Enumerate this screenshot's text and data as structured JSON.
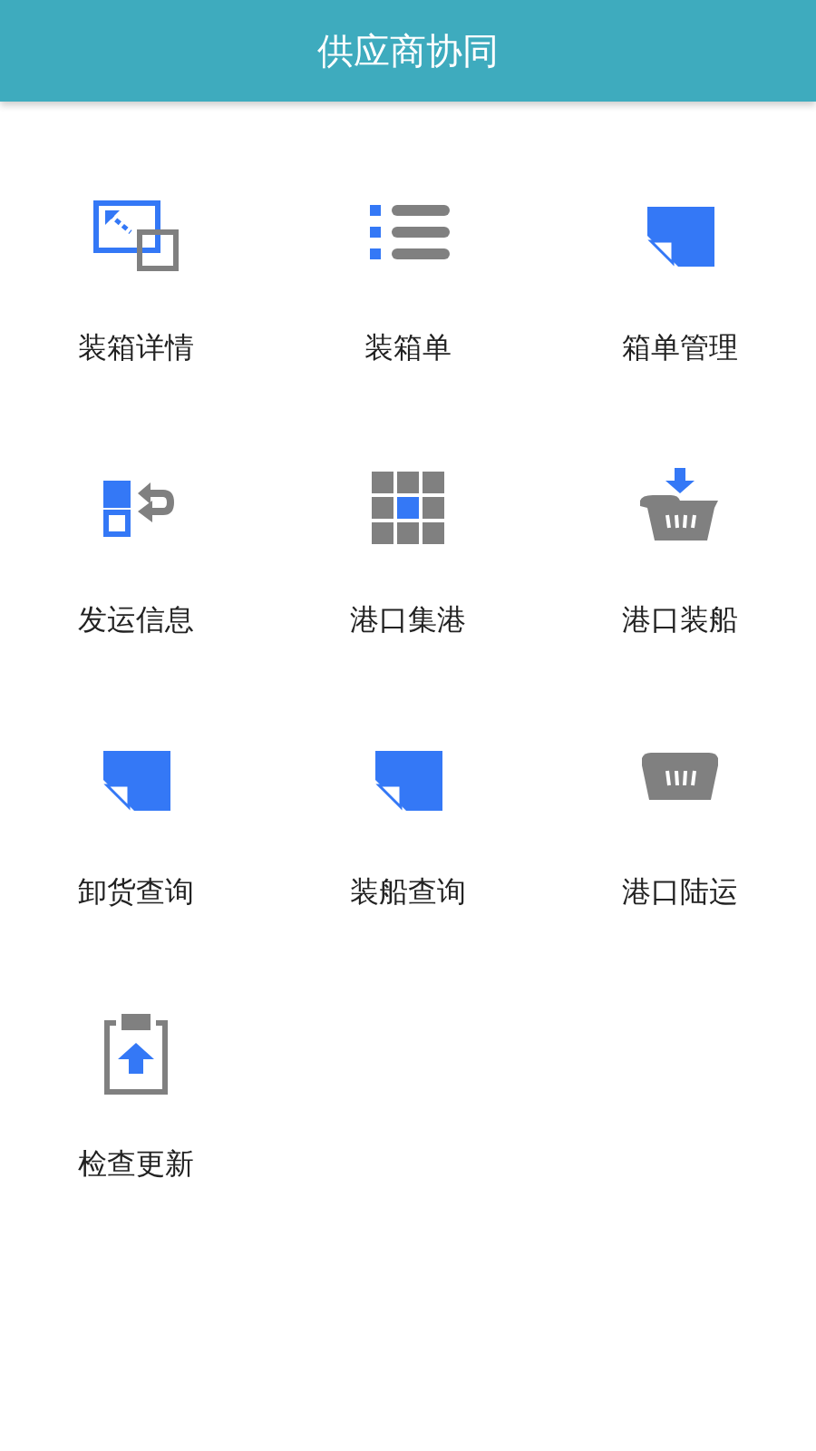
{
  "header": {
    "title": "供应商协同"
  },
  "menu": [
    {
      "label": "装箱详情",
      "kind": "resize"
    },
    {
      "label": "装箱单",
      "kind": "list"
    },
    {
      "label": "箱单管理",
      "kind": "note"
    },
    {
      "label": "发运信息",
      "kind": "swap"
    },
    {
      "label": "港口集港",
      "kind": "grid"
    },
    {
      "label": "港口装船",
      "kind": "basket-down"
    },
    {
      "label": "卸货查询",
      "kind": "note"
    },
    {
      "label": "装船查询",
      "kind": "note"
    },
    {
      "label": "港口陆运",
      "kind": "basket"
    },
    {
      "label": "检查更新",
      "kind": "upload"
    }
  ]
}
